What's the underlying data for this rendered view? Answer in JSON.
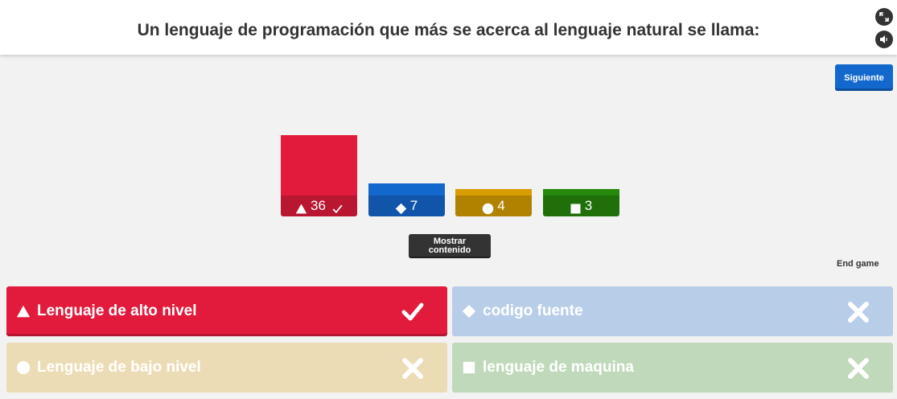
{
  "question": "Un lenguaje de programación que más se acerca al lenguaje natural se llama:",
  "header": {
    "fullscreen_icon": "expand-icon",
    "sound_icon": "speaker-icon"
  },
  "next_button": "Siguiente",
  "show_content_button": [
    "Mostrar",
    "contenido"
  ],
  "end_game": "End game",
  "results": [
    {
      "shape": "triangle",
      "count": 36,
      "correct": true,
      "color": "#e21b3c"
    },
    {
      "shape": "diamond",
      "count": 7,
      "correct": false,
      "color": "#1368ce"
    },
    {
      "shape": "circle",
      "count": 4,
      "correct": false,
      "color": "#d89e00"
    },
    {
      "shape": "square",
      "count": 3,
      "correct": false,
      "color": "#26890c"
    }
  ],
  "answers": [
    {
      "shape": "triangle",
      "text": "Lenguaje de alto nivel",
      "correct": true,
      "color": "#e21b3c"
    },
    {
      "shape": "diamond",
      "text": "codigo fuente",
      "correct": false,
      "color": "#b8cde8"
    },
    {
      "shape": "circle",
      "text": "Lenguaje de bajo nivel",
      "correct": false,
      "color": "#ecdcb5"
    },
    {
      "shape": "square",
      "text": "lenguaje de maquina",
      "correct": false,
      "color": "#c0d9ba"
    }
  ]
}
